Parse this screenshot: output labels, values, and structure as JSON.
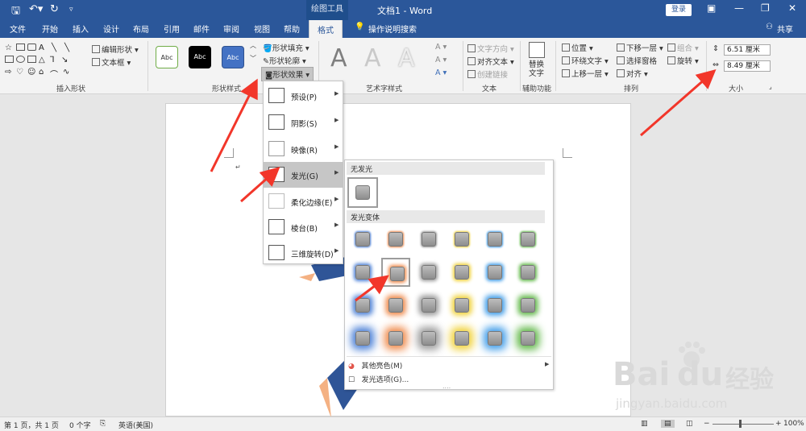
{
  "titlebar": {
    "context_tab": "绘图工具",
    "title": "文档1 - Word",
    "login": "登录",
    "quick_access": [
      "save-icon",
      "undo-icon",
      "redo-icon",
      "customize-icon"
    ]
  },
  "tabs": [
    "文件",
    "开始",
    "插入",
    "设计",
    "布局",
    "引用",
    "邮件",
    "审阅",
    "视图",
    "帮助",
    "格式"
  ],
  "tell_me": "操作说明搜索",
  "share": "共享",
  "ribbon": {
    "insert_shapes": {
      "edit_shape": "编辑形状",
      "text_box": "文本框",
      "label": "插入形状"
    },
    "shape_styles": {
      "label": "形状样式",
      "preset": "Abc",
      "fill": "形状填充",
      "outline": "形状轮廓",
      "effect": "形状效果"
    },
    "wordart": {
      "label": "艺术字样式",
      "letter": "A"
    },
    "text": {
      "label": "文本",
      "direction": "文字方向",
      "align": "对齐文本",
      "link": "创建链接"
    },
    "accessibility": {
      "label": "辅助功能",
      "alt_text": "替换\n文字"
    },
    "arrange": {
      "label": "排列",
      "position": "位置",
      "wrap": "环绕文字",
      "forward": "上移一层",
      "backward": "下移一层",
      "pane": "选择窗格",
      "align": "对齐",
      "group": "组合",
      "rotate": "旋转"
    },
    "size": {
      "label": "大小",
      "height": "6.51 厘米",
      "width": "8.49 厘米"
    }
  },
  "menu": {
    "items": [
      {
        "label": "预设(P)"
      },
      {
        "label": "阴影(S)"
      },
      {
        "label": "映像(R)"
      },
      {
        "label": "发光(G)",
        "selected": true
      },
      {
        "label": "柔化边缘(E)"
      },
      {
        "label": "棱台(B)"
      },
      {
        "label": "三维旋转(D)"
      }
    ]
  },
  "glow": {
    "no_glow_header": "无发光",
    "variants_header": "发光变体",
    "colors": [
      "#4a7fd6",
      "#ef8a4b",
      "#9a9a9a",
      "#f0d23a",
      "#3f9ce8",
      "#62b84a"
    ],
    "more_colors": "其他亮色(M)",
    "options": "发光选项(G)..."
  },
  "status": {
    "page": "第 1 页，共 1 页",
    "words": "0 个字",
    "lang": "英语(美国)",
    "zoom": "100%"
  },
  "watermark": {
    "brand": "Bai",
    "brand2": "du",
    "brand_cn": "经验",
    "url": "jingyan.baidu.com"
  }
}
